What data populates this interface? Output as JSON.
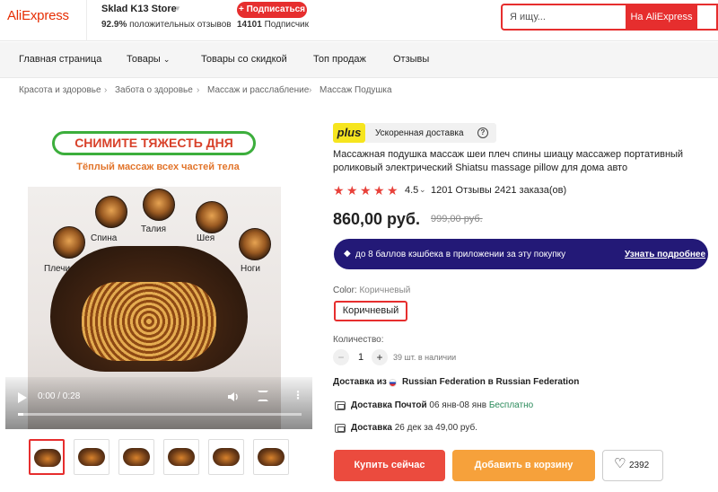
{
  "header": {
    "logo": "AliExpress",
    "store_name": "Sklad K13 Store",
    "positive_pct": "92.9%",
    "positive_label": "положительных отзывов",
    "subscribe_label": "+ Подписаться",
    "followers_count": "14101",
    "followers_label": "Подписчик",
    "search_placeholder": "Я ищу...",
    "search_button": "На AliExpress"
  },
  "nav": {
    "items": [
      {
        "label": "Главная страница"
      },
      {
        "label": "Товары"
      },
      {
        "label": "Товары со скидкой"
      },
      {
        "label": "Топ продаж"
      },
      {
        "label": "Отзывы"
      }
    ]
  },
  "breadcrumb": [
    "Красота и здоровье",
    "Забота о здоровье",
    "Массаж и расслабление",
    "Массаж Подушка"
  ],
  "gallery": {
    "banner": "СНИМИТЕ ТЯЖЕСТЬ ДНЯ",
    "banner_sub": "Тёплый массаж всех частей тела",
    "spots": [
      "Спина",
      "Талия",
      "Шея",
      "Плечи",
      "Ноги"
    ],
    "video_time": "0:00 / 0:28",
    "video_progress": 0.02,
    "thumb_count": 6
  },
  "product": {
    "plus_badge": "plus",
    "plus_text": "Ускоренная доставка",
    "title": "Массажная подушка массаж шеи плеч спины шиацу массажер портативный роликовый электрический Shiatsu massage pillow для дома авто",
    "rating": "4.5",
    "rating_value": 4.5,
    "reviews": "1201 Отзывы",
    "orders": "2421 заказа(ов)",
    "price": "860,00 руб.",
    "old_price": "999,00 руб.",
    "cashback_text": "до 8 баллов кэшбека в приложении за эту покупку",
    "cashback_link": "Узнать подробнее",
    "color_label": "Color:",
    "color_value": "Коричневый",
    "color_chip": "Коричневый",
    "qty_label": "Количество:",
    "qty_value": "1",
    "qty_stock": "39 шт. в наличии",
    "ship_from_label": "Доставка из",
    "ship_from_country": "Russian Federation в Russian Federation",
    "delivery1_label": "Доставка Почтой",
    "delivery1_dates": "06 янв-08 янв",
    "delivery1_price": "Бесплатно",
    "delivery2_label": "Доставка",
    "delivery2_detail": "26 дек за 49,00 руб.",
    "buy_label": "Купить сейчас",
    "cart_label": "Добавить в корзину",
    "wish_count": "2392"
  },
  "colors": {
    "accent": "#e62e2e",
    "cashback_bg": "#231977",
    "plus_yellow": "#f6e51e",
    "cart_orange": "#f6a13b"
  }
}
